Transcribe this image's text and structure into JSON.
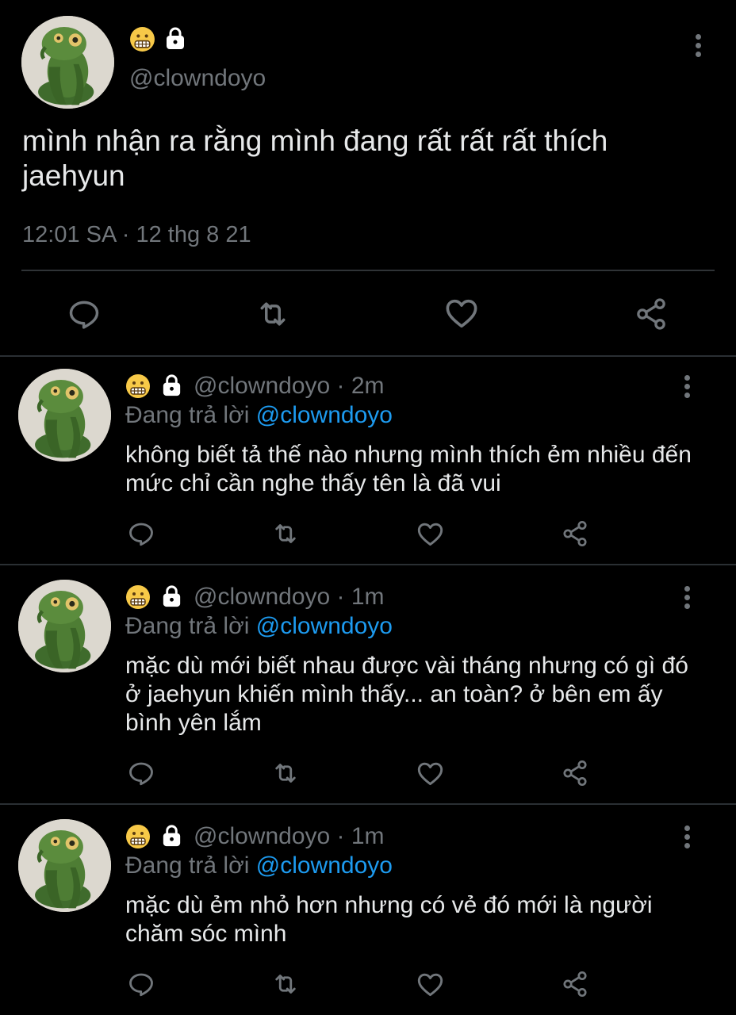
{
  "main_tweet": {
    "handle": "@clowndoyo",
    "text": "mình nhận ra rằng mình đang rất rất rất thích jaehyun",
    "timestamp": "12:01 SA · 12 thg 8 21"
  },
  "replies": [
    {
      "header": "@clowndoyo · 2m",
      "replying_label": "Đang trả lời",
      "replying_to": "@clowndoyo",
      "text": "không biết tả thế nào nhưng mình thích ẻm nhiều đến mức chỉ cần nghe thấy tên là đã vui"
    },
    {
      "header": "@clowndoyo · 1m",
      "replying_label": "Đang trả lời",
      "replying_to": "@clowndoyo",
      "text": "mặc dù mới biết nhau được vài tháng nhưng có gì đó ở jaehyun khiến mình thấy... an toàn? ở bên em ấy bình yên lắm"
    },
    {
      "header": "@clowndoyo · 1m",
      "replying_label": "Đang trả lời",
      "replying_to": "@clowndoyo",
      "text": "mặc dù ẻm nhỏ hơn nhưng có vẻ đó mới là người chăm sóc mình"
    }
  ],
  "colors": {
    "background": "#000000",
    "text": "#e7e9ea",
    "muted": "#71767b",
    "link": "#1d9bf0"
  },
  "icons": [
    "grimacing-emoji-icon",
    "lock-icon",
    "more-options-icon",
    "reply-icon",
    "retweet-icon",
    "like-icon",
    "share-icon"
  ]
}
